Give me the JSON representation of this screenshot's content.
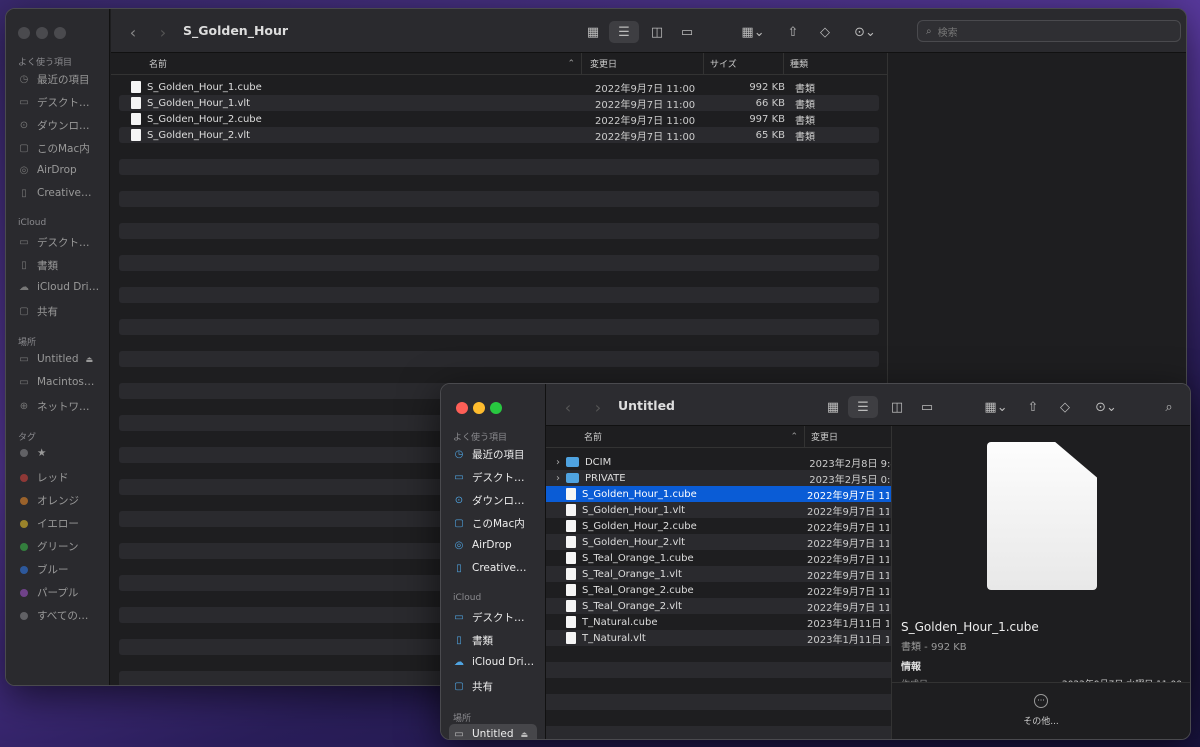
{
  "back_window": {
    "title": "S_Golden_Hour",
    "search_placeholder": "検索",
    "sidebar": {
      "favorites_header": "よく使う項目",
      "favorites": [
        "最近の項目",
        "デスクト…",
        "ダウンロ…",
        "このMac内",
        "AirDrop",
        "Creative…"
      ],
      "icloud_header": "iCloud",
      "icloud": [
        "デスクト…",
        "書類",
        "iCloud Dri…",
        "共有"
      ],
      "locations_header": "場所",
      "locations": [
        "Untitled",
        "Macintos…",
        "ネットワ…"
      ],
      "tags_header": "タグ",
      "tags": [
        {
          "label": "★",
          "color": "#8e8e93"
        },
        {
          "label": "レッド",
          "color": "#e0443e"
        },
        {
          "label": "オレンジ",
          "color": "#f5902a"
        },
        {
          "label": "イエロー",
          "color": "#f5cc2a"
        },
        {
          "label": "グリーン",
          "color": "#3bc24a"
        },
        {
          "label": "ブルー",
          "color": "#2f7df6"
        },
        {
          "label": "パープル",
          "color": "#a855d6"
        },
        {
          "label": "すべての…",
          "color": "#8e8e93"
        }
      ]
    },
    "columns": {
      "name": "名前",
      "date": "変更日",
      "size": "サイズ",
      "kind": "種類"
    },
    "files": [
      {
        "name": "S_Golden_Hour_1.cube",
        "date": "2022年9月7日 11:00",
        "size": "992 KB",
        "kind": "書類"
      },
      {
        "name": "S_Golden_Hour_1.vlt",
        "date": "2022年9月7日 11:00",
        "size": "66 KB",
        "kind": "書類"
      },
      {
        "name": "S_Golden_Hour_2.cube",
        "date": "2022年9月7日 11:00",
        "size": "997 KB",
        "kind": "書類"
      },
      {
        "name": "S_Golden_Hour_2.vlt",
        "date": "2022年9月7日 11:00",
        "size": "65 KB",
        "kind": "書類"
      }
    ]
  },
  "front_window": {
    "title": "Untitled",
    "sidebar": {
      "favorites_header": "よく使う項目",
      "favorites": [
        "最近の項目",
        "デスクト…",
        "ダウンロ…",
        "このMac内",
        "AirDrop",
        "Creative…"
      ],
      "icloud_header": "iCloud",
      "icloud": [
        "デスクト…",
        "書類",
        "iCloud Dri…",
        "共有"
      ],
      "locations_header": "場所",
      "locations": [
        "Untitled"
      ]
    },
    "columns": {
      "name": "名前",
      "date": "変更日"
    },
    "files": [
      {
        "name": "DCIM",
        "date": "2023年2月8日 9:4",
        "folder": true
      },
      {
        "name": "PRIVATE",
        "date": "2023年2月5日 0:1",
        "folder": true
      },
      {
        "name": "S_Golden_Hour_1.cube",
        "date": "2022年9月7日 11:",
        "selected": true
      },
      {
        "name": "S_Golden_Hour_1.vlt",
        "date": "2022年9月7日 11:"
      },
      {
        "name": "S_Golden_Hour_2.cube",
        "date": "2022年9月7日 11:"
      },
      {
        "name": "S_Golden_Hour_2.vlt",
        "date": "2022年9月7日 11:"
      },
      {
        "name": "S_Teal_Orange_1.cube",
        "date": "2022年9月7日 11:"
      },
      {
        "name": "S_Teal_Orange_1.vlt",
        "date": "2022年9月7日 11:"
      },
      {
        "name": "S_Teal_Orange_2.cube",
        "date": "2022年9月7日 11:"
      },
      {
        "name": "S_Teal_Orange_2.vlt",
        "date": "2022年9月7日 11:"
      },
      {
        "name": "T_Natural.cube",
        "date": "2023年1月11日 11:"
      },
      {
        "name": "T_Natural.vlt",
        "date": "2023年1月11日 11:"
      }
    ],
    "preview": {
      "filename": "S_Golden_Hour_1.cube",
      "meta": "書類 - 992 KB",
      "info_header": "情報",
      "created_label": "作成日",
      "created_value": "2022年9月7日 水曜日 11:00",
      "more_label": "その他..."
    }
  },
  "colors": {
    "accent": "#0a5cd6",
    "window_bg": "#1e1e20",
    "sidebar_bg": "#2a2a2e"
  }
}
